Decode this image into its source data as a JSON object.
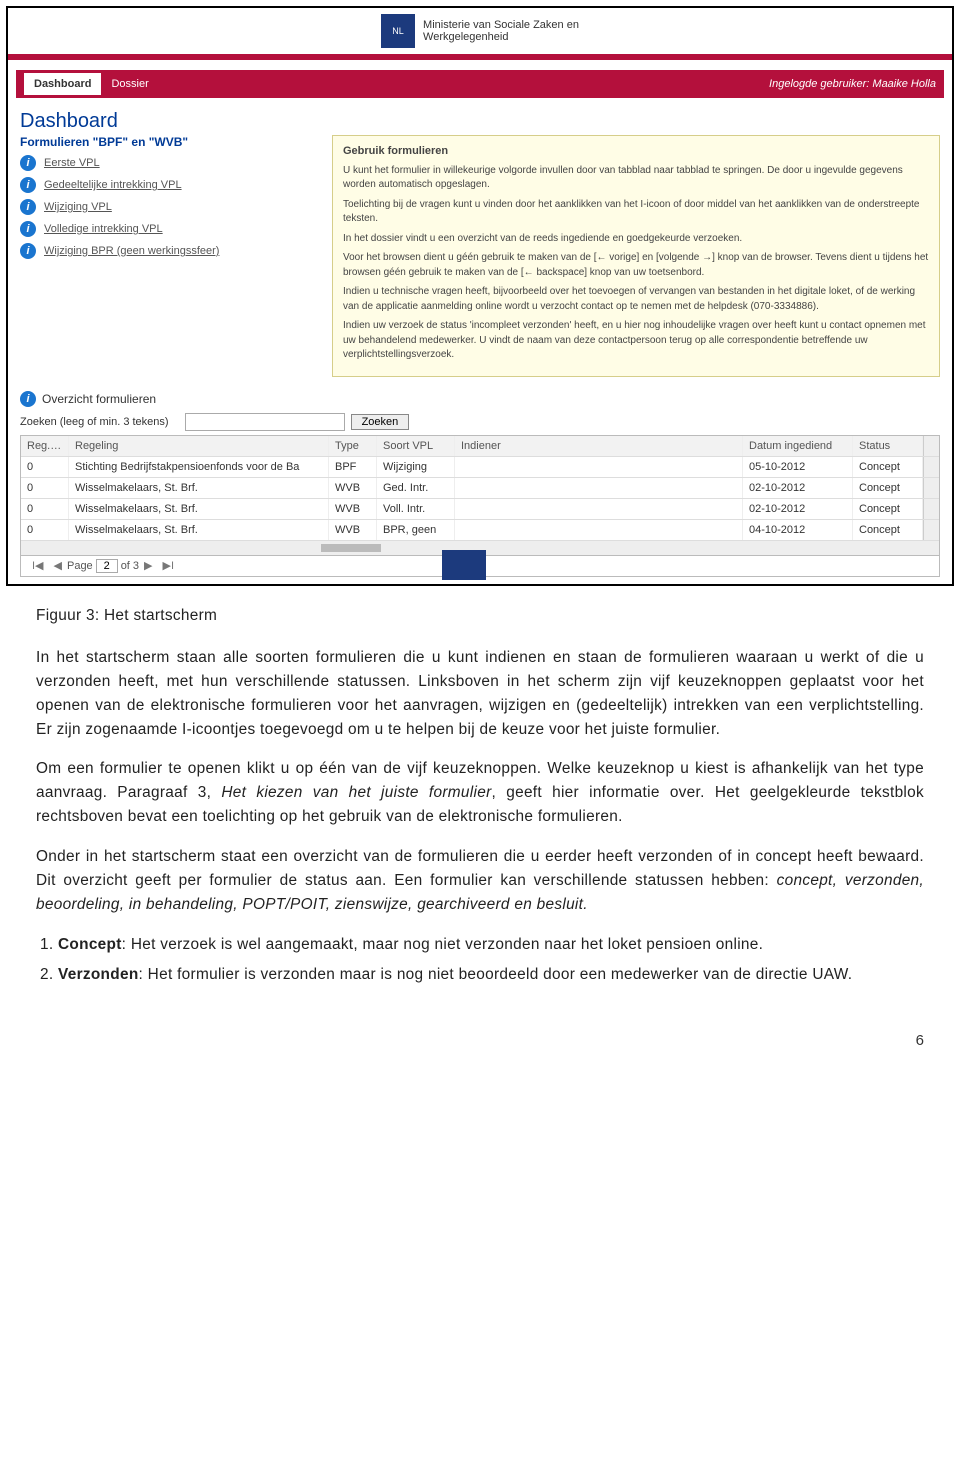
{
  "gov_header": {
    "ministry_line1": "Ministerie van Sociale Zaken en",
    "ministry_line2": "Werkgelegenheid"
  },
  "nav": {
    "tabs": [
      "Dashboard",
      "Dossier"
    ],
    "logged_in_label": "Ingelogde gebruiker:",
    "logged_in_user": "Maaike Holla"
  },
  "dashboard": {
    "title": "Dashboard",
    "section_title": "Formulieren \"BPF\" en \"WVB\"",
    "form_links": [
      "Eerste VPL",
      "Gedeeltelijke intrekking VPL",
      "Wijziging VPL",
      "Volledige intrekking VPL",
      "Wijziging BPR (geen werkingssfeer)"
    ]
  },
  "info_panel": {
    "title": "Gebruik formulieren",
    "paragraphs": [
      "U kunt het formulier in willekeurige volgorde invullen door van tabblad naar tabblad te springen. De door u ingevulde gegevens worden automatisch opgeslagen.",
      "Toelichting bij de vragen kunt u vinden door het aanklikken van het I-icoon of door middel van het aanklikken van de onderstreepte teksten.",
      "In het dossier vindt u een overzicht van de reeds ingediende en goedgekeurde verzoeken.",
      "Voor het browsen dient u géén gebruik te maken van de [← vorige] en [volgende →] knop van de browser. Tevens dient u tijdens het browsen géén gebruik te maken van de [← backspace] knop van uw toetsenbord.",
      "Indien u technische vragen heeft, bijvoorbeeld over het toevoegen of vervangen van bestanden in het digitale loket, of de werking van de applicatie aanmelding online wordt u verzocht contact op te nemen met de helpdesk (070-3334886).",
      "Indien uw verzoek de status 'incompleet verzonden' heeft, en u hier nog inhoudelijke vragen over heeft kunt u contact opnemen met uw behandelend medewerker. U vindt de naam van deze contactpersoon terug op alle correspondentie betreffende uw verplichtstellingsverzoek."
    ]
  },
  "overview": {
    "header": "Overzicht formulieren",
    "search_label": "Zoeken (leeg of min. 3 tekens)",
    "search_button": "Zoeken",
    "columns": [
      "Reg.Nr.",
      "Regeling",
      "Type",
      "Soort VPL",
      "Indiener",
      "Datum ingediend",
      "Status"
    ],
    "rows": [
      {
        "regnr": "0",
        "regeling": "Stichting Bedrijfstakpensioenfonds voor de Ba",
        "type": "BPF",
        "soort": "Wijziging",
        "indiener": "",
        "datum": "05-10-2012",
        "status": "Concept"
      },
      {
        "regnr": "0",
        "regeling": "Wisselmakelaars, St. Brf.",
        "type": "WVB",
        "soort": "Ged. Intr.",
        "indiener": "",
        "datum": "02-10-2012",
        "status": "Concept"
      },
      {
        "regnr": "0",
        "regeling": "Wisselmakelaars, St. Brf.",
        "type": "WVB",
        "soort": "Voll. Intr.",
        "indiener": "",
        "datum": "02-10-2012",
        "status": "Concept"
      },
      {
        "regnr": "0",
        "regeling": "Wisselmakelaars, St. Brf.",
        "type": "WVB",
        "soort": "BPR, geen",
        "indiener": "",
        "datum": "04-10-2012",
        "status": "Concept"
      }
    ],
    "pager": {
      "first": "I◀",
      "prev": "◀",
      "page_label": "Page",
      "page_value": "2",
      "of_label": "of 3",
      "next": "▶",
      "last": "▶I"
    }
  },
  "document": {
    "caption": "Figuur 3: Het startscherm",
    "p1": "In het startscherm staan alle soorten formulieren die u kunt indienen en staan de formulieren waaraan u werkt of die u verzonden heeft, met hun verschillende statussen. Linksboven in het scherm zijn vijf keuzeknoppen geplaatst voor het openen van de elektronische formulieren voor het aanvragen, wijzigen en (gedeeltelijk) intrekken van een verplichtstelling. Er zijn zogenaamde I-icoontjes toegevoegd om u te helpen bij de keuze voor het juiste formulier.",
    "p2_a": "Om een formulier te openen klikt u op één van de vijf keuzeknoppen. Welke keuzeknop u kiest is afhankelijk van het type aanvraag. Paragraaf 3, ",
    "p2_it": "Het kiezen van het juiste formulier",
    "p2_b": ", geeft hier informatie over. Het geelgekleurde tekstblok rechtsboven bevat een toelichting op het gebruik van de elektronische formulieren.",
    "p3_a": "Onder in het startscherm staat een overzicht van de formulieren die u eerder heeft verzonden of in concept heeft bewaard. Dit overzicht geeft per formulier de status aan. Een formulier kan verschillende statussen hebben: ",
    "p3_it": "concept, verzonden, beoordeling, in behandeling, POPT/POIT, zienswijze, gearchiveerd en besluit.",
    "li1_label": "Concept",
    "li1_text": ": Het verzoek is wel aangemaakt, maar nog niet verzonden naar het loket pensioen online.",
    "li2_label": "Verzonden",
    "li2_text": ": Het formulier is verzonden maar is nog niet beoordeeld door een medewerker van de directie UAW.",
    "page_number": "6"
  }
}
